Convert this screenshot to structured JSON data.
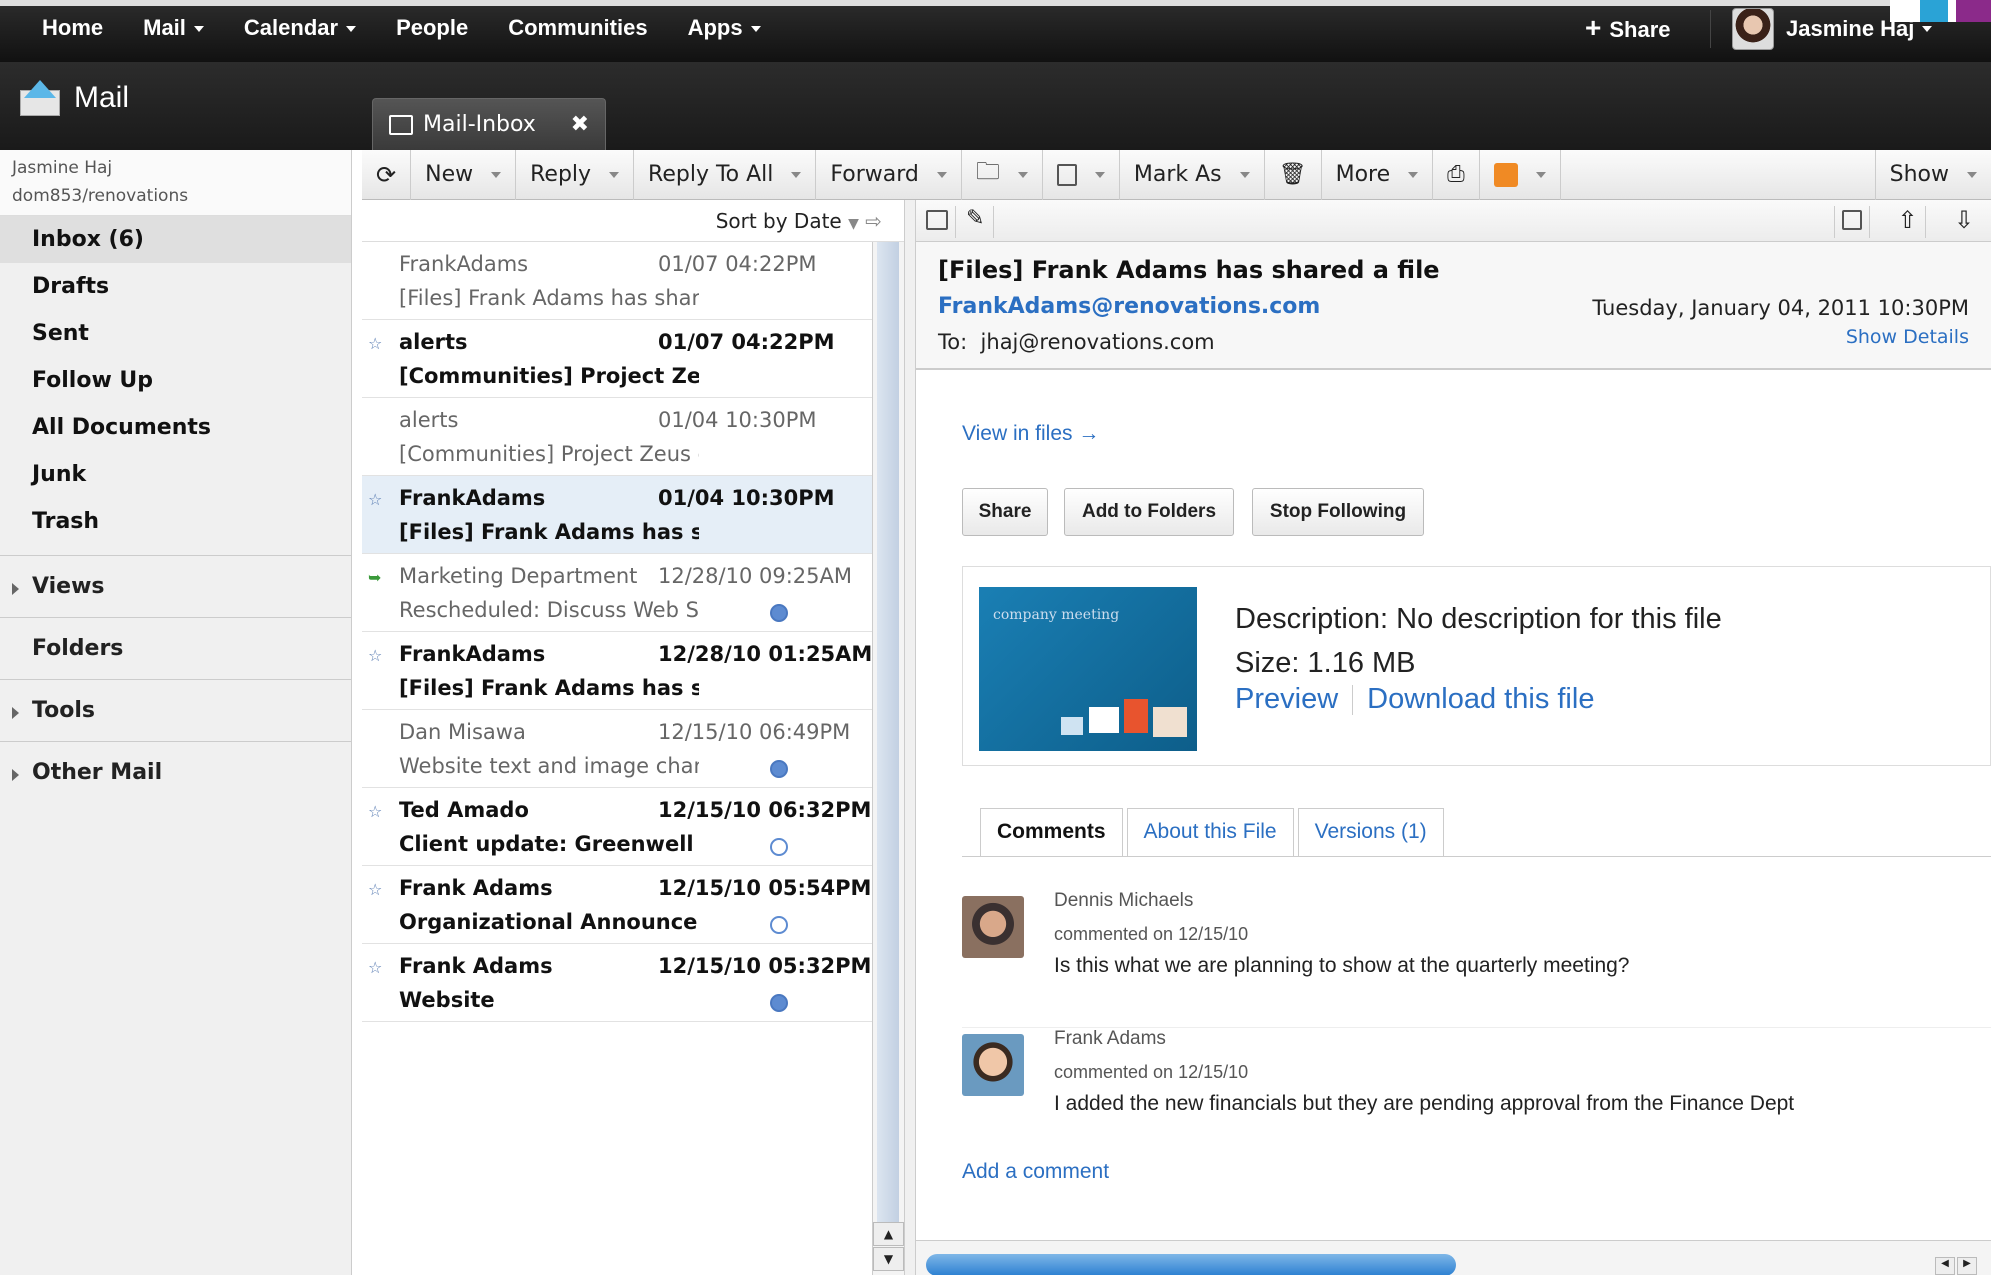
{
  "topnav": {
    "items": [
      {
        "label": "Home",
        "dropdown": false
      },
      {
        "label": "Mail",
        "dropdown": true
      },
      {
        "label": "Calendar",
        "dropdown": true
      },
      {
        "label": "People",
        "dropdown": false
      },
      {
        "label": "Communities",
        "dropdown": false
      },
      {
        "label": "Apps",
        "dropdown": true
      }
    ],
    "share_label": "Share",
    "user_name": "Jasmine Haj"
  },
  "app": {
    "title": "Mail"
  },
  "tab": {
    "label": "Mail-Inbox",
    "close": "✖"
  },
  "account": {
    "name": "Jasmine Haj",
    "path": "dom853/renovations"
  },
  "sidebar": {
    "folders": [
      "Inbox (6)",
      "Drafts",
      "Sent",
      "Follow Up",
      "All Documents",
      "Junk",
      "Trash"
    ],
    "sections": [
      "Views",
      "Folders",
      "Tools",
      "Other Mail"
    ]
  },
  "toolbar": {
    "new": "New",
    "reply": "Reply",
    "reply_all": "Reply To All",
    "forward": "Forward",
    "mark_as": "Mark As",
    "more": "More",
    "show": "Show"
  },
  "list": {
    "sort_label": "Sort by Date",
    "rows": [
      {
        "from": "FrankAdams",
        "date": "01/07 04:22PM",
        "subject": "[Files] Frank Adams has shared a fi",
        "unread": false,
        "star": false,
        "selected": false,
        "dot": ""
      },
      {
        "from": "alerts",
        "date": "01/07 04:22PM",
        "subject": "[Communities] Project Zeus cont",
        "unread": true,
        "star": true,
        "selected": false,
        "dot": ""
      },
      {
        "from": "alerts",
        "date": "01/04 10:30PM",
        "subject": "[Communities] Project Zeus conten",
        "unread": false,
        "star": false,
        "selected": false,
        "dot": ""
      },
      {
        "from": "FrankAdams",
        "date": "01/04 10:30PM",
        "subject": "[Files] Frank Adams has shared a",
        "unread": true,
        "star": true,
        "selected": true,
        "dot": ""
      },
      {
        "from": "Marketing Department",
        "date": "12/28/10 09:25AM",
        "subject": "Rescheduled: Discuss Web Site (De",
        "unread": false,
        "star": false,
        "selected": false,
        "dot": "filled",
        "fwd": true
      },
      {
        "from": "FrankAdams",
        "date": "12/28/10 01:25AM",
        "subject": "[Files] Frank Adams has shared a",
        "unread": true,
        "star": true,
        "selected": false,
        "dot": ""
      },
      {
        "from": "Dan Misawa",
        "date": "12/15/10 06:49PM",
        "subject": "Website text and image changes",
        "unread": false,
        "star": false,
        "selected": false,
        "dot": "filled"
      },
      {
        "from": "Ted Amado",
        "date": "12/15/10 06:32PM",
        "subject": "Client update: Greenwell report",
        "unread": true,
        "star": true,
        "selected": false,
        "dot": "open"
      },
      {
        "from": "Frank Adams",
        "date": "12/15/10 05:54PM",
        "subject": "Organizational Announcement",
        "unread": true,
        "star": true,
        "selected": false,
        "dot": "open"
      },
      {
        "from": "Frank Adams",
        "date": "12/15/10 05:32PM",
        "subject": "Website",
        "unread": true,
        "star": true,
        "selected": false,
        "dot": "filled"
      }
    ]
  },
  "message": {
    "subject": "[Files] Frank Adams has shared a file",
    "from": "FrankAdams@renovations.com",
    "date": "Tuesday, January 04, 2011 10:30PM",
    "to_label": "To:",
    "to": "jhaj@renovations.com",
    "show_details": "Show Details",
    "view_in_files": "View in files →",
    "buttons": {
      "share": "Share",
      "add_to_folders": "Add to Folders",
      "stop_following": "Stop Following"
    },
    "file": {
      "thumb_text": "company meeting",
      "description": "Description: No description for this file",
      "size": "Size: 1.16 MB",
      "preview": "Preview",
      "download": "Download this file"
    },
    "tabs": {
      "comments": "Comments",
      "about": "About this File",
      "versions": "Versions (1)"
    },
    "comments": [
      {
        "name": "Dennis Michaels",
        "when": "commented on 12/15/10",
        "text": "Is this what we are planning to show at the quarterly meeting?"
      },
      {
        "name": "Frank Adams",
        "when": "commented on 12/15/10",
        "text": "I added the new financials but they are pending approval from the Finance Dept"
      }
    ],
    "add_comment": "Add a comment"
  },
  "colors": {
    "accent": "#2b6fc2",
    "from_orange": "#e67a2e",
    "unread_dot": "#5d8bd1"
  }
}
